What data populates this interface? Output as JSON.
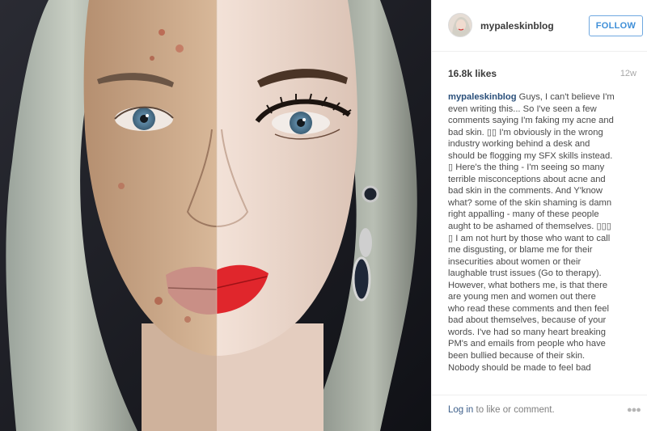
{
  "post": {
    "photo_name": "half-face-acne-makeup-photo"
  },
  "header": {
    "username": "mypaleskinblog",
    "follow_label": "FOLLOW"
  },
  "meta": {
    "likes": "16.8k likes",
    "age": "12w"
  },
  "caption": {
    "username": "mypaleskinblog",
    "lines": [
      "Guys, I can't believe I'm",
      "even writing this... So I've seen a few",
      "comments saying I'm faking my acne and",
      "bad skin. ▯▯ I'm obviously in the wrong",
      "industry working behind a desk and",
      "should be flogging my SFX skills instead.",
      "▯ Here's the thing - I'm seeing so many",
      "terrible misconceptions about acne and",
      "bad skin in the comments. And Y'know",
      "what? some of the skin shaming is damn",
      "right appalling - many of these people",
      "aught to be ashamed of themselves. ▯▯▯",
      "▯ I am not hurt by those who want to call",
      "me disgusting, or blame me for their",
      "insecurities about women or their",
      "laughable trust issues (Go to therapy).",
      "However, what bothers me, is that there",
      "are young men and women out there",
      "who read these comments and then feel",
      "bad about themselves, because of your",
      "words. I've had so many heart breaking",
      "PM's and emails from people who have",
      "been bullied because of their skin.",
      "Nobody should be made to feel bad"
    ]
  },
  "footer": {
    "login_link": "Log in",
    "login_rest": " to like or comment.",
    "more_icon": "more-options-icon"
  }
}
